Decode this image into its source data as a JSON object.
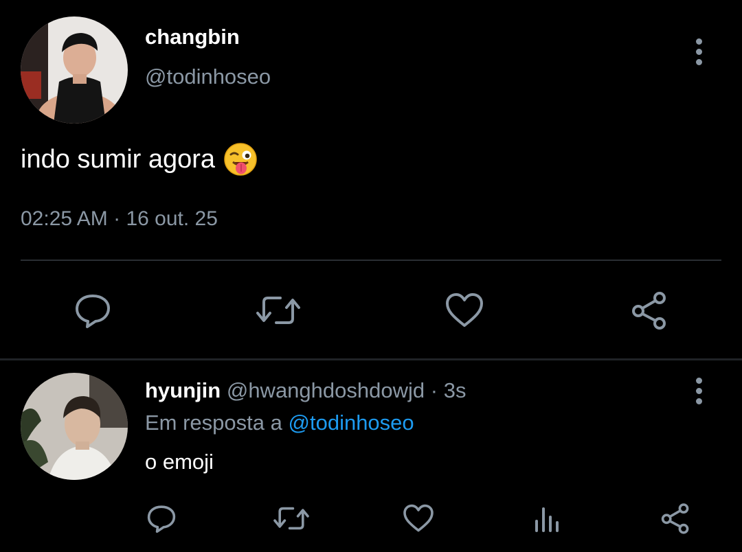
{
  "main_tweet": {
    "display_name": "changbin",
    "handle": "@todinhoseo",
    "text": "indo sumir agora",
    "emoji": "winking-face-with-tongue",
    "time": "02:25 AM",
    "separator": "·",
    "date": "16 out. 25",
    "actions": [
      "reply-icon",
      "retweet-icon",
      "like-icon",
      "share-icon"
    ]
  },
  "reply": {
    "display_name": "hyunjin",
    "handle": "@hwanghdoshdowjd",
    "separator": "·",
    "age": "3s",
    "reply_prefix": "Em resposta a",
    "reply_mention": "@todinhoseo",
    "text": "o emoji",
    "actions": [
      "reply-icon",
      "retweet-icon",
      "like-icon",
      "analytics-icon",
      "share-icon"
    ]
  },
  "colors": {
    "background": "#000000",
    "primary_text": "#ffffff",
    "secondary_text": "#8b98a5",
    "link": "#1d9bf0",
    "divider": "#2a2e33"
  }
}
